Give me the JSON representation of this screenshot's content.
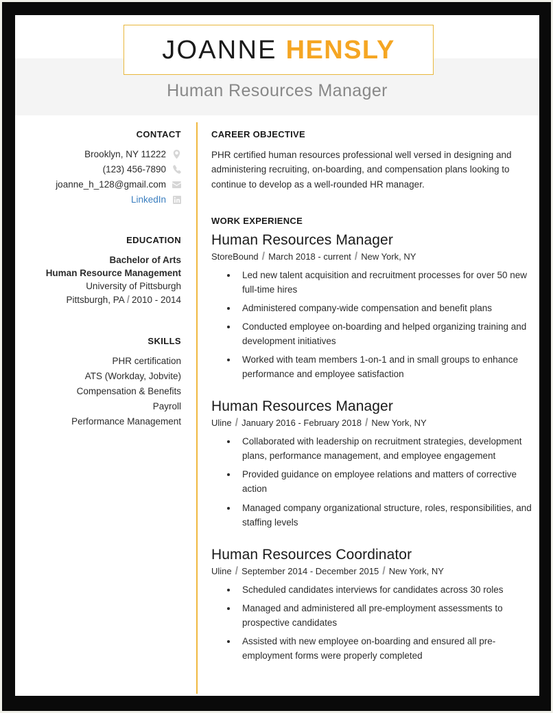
{
  "header": {
    "name_first": "JOANNE",
    "name_last": "HENSLY",
    "job_subtitle": "Human Resources Manager",
    "accent_color": "#f5a623",
    "box_border_color": "#e9b73c",
    "band_color": "#f4f4f4"
  },
  "sidebar": {
    "contact": {
      "heading": "CONTACT",
      "items": [
        {
          "text": "Brooklyn, NY 11222",
          "icon": "map-pin-icon",
          "is_link": false
        },
        {
          "text": "(123) 456-7890",
          "icon": "phone-icon",
          "is_link": false
        },
        {
          "text": "joanne_h_128@gmail.com",
          "icon": "envelope-icon",
          "is_link": false
        },
        {
          "text": "LinkedIn",
          "icon": "linkedin-icon",
          "is_link": true
        }
      ],
      "link_color": "#3a7ebf",
      "icon_color": "#d6d6d6"
    },
    "education": {
      "heading": "EDUCATION",
      "degree": "Bachelor of Arts",
      "field": "Human Resource Management",
      "school": "University of Pittsburgh",
      "location": "Pittsburgh, PA",
      "separator": "/",
      "years": "2010 - 2014"
    },
    "skills": {
      "heading": "SKILLS",
      "items": [
        "PHR certification",
        "ATS (Workday, Jobvite)",
        "Compensation & Benefits",
        "Payroll",
        "Performance Management"
      ]
    }
  },
  "main": {
    "objective": {
      "heading": "CAREER OBJECTIVE",
      "text": "PHR certified human resources professional well versed in designing and administering recruiting, on-boarding, and compensation plans looking to continue to develop as a well-rounded HR manager."
    },
    "work": {
      "heading": "WORK EXPERIENCE",
      "separator": "/",
      "jobs": [
        {
          "title": "Human Resources Manager",
          "company": "StoreBound",
          "dates": "March 2018 - current",
          "location": "New York, NY",
          "bullets": [
            "Led new talent acquisition and recruitment processes for over 50 new full-time hires",
            "Administered company-wide compensation and benefit plans",
            "Conducted employee on-boarding and helped organizing training and development initiatives",
            "Worked with team members 1-on-1 and in small groups to enhance performance and employee satisfaction"
          ]
        },
        {
          "title": "Human Resources Manager",
          "company": "Uline",
          "dates": "January 2016 - February 2018",
          "location": "New York, NY",
          "bullets": [
            "Collaborated with leadership on recruitment strategies, development plans, performance management, and employee engagement",
            "Provided guidance on employee relations and matters of corrective action",
            "Managed company organizational structure, roles, responsibilities, and staffing levels"
          ]
        },
        {
          "title": "Human Resources Coordinator",
          "company": "Uline",
          "dates": "September 2014 - December 2015",
          "location": "New York, NY",
          "bullets": [
            "Scheduled candidates interviews for candidates across 30 roles",
            "Managed and administered all pre-employment assessments to prospective candidates",
            "Assisted with new employee on-boarding and ensured all pre-employment forms were properly completed"
          ]
        }
      ]
    }
  },
  "divider_color": "#f0b840"
}
